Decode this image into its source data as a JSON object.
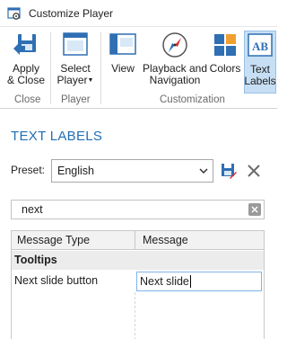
{
  "window": {
    "title": "Customize Player"
  },
  "ribbon": {
    "buttons": {
      "apply_close": "Apply\n& Close",
      "select_player": "Select\nPlayer",
      "view": "View",
      "playback_navigation": "Playback and\nNavigation",
      "colors": "Colors",
      "text_labels": "Text\nLabels"
    },
    "groups": {
      "close": "Close",
      "player": "Player",
      "customization": "Customization"
    }
  },
  "panel": {
    "section_title": "TEXT LABELS",
    "preset_label": "Preset:",
    "preset_value": "English",
    "search_value": "next"
  },
  "grid": {
    "columns": [
      "Message Type",
      "Message"
    ],
    "group": "Tooltips",
    "rows": [
      {
        "type": "Next slide button",
        "message": "Next slide"
      }
    ]
  },
  "colors": {
    "accent": "#1f6fb5",
    "active_tab": "#c7dff4"
  }
}
